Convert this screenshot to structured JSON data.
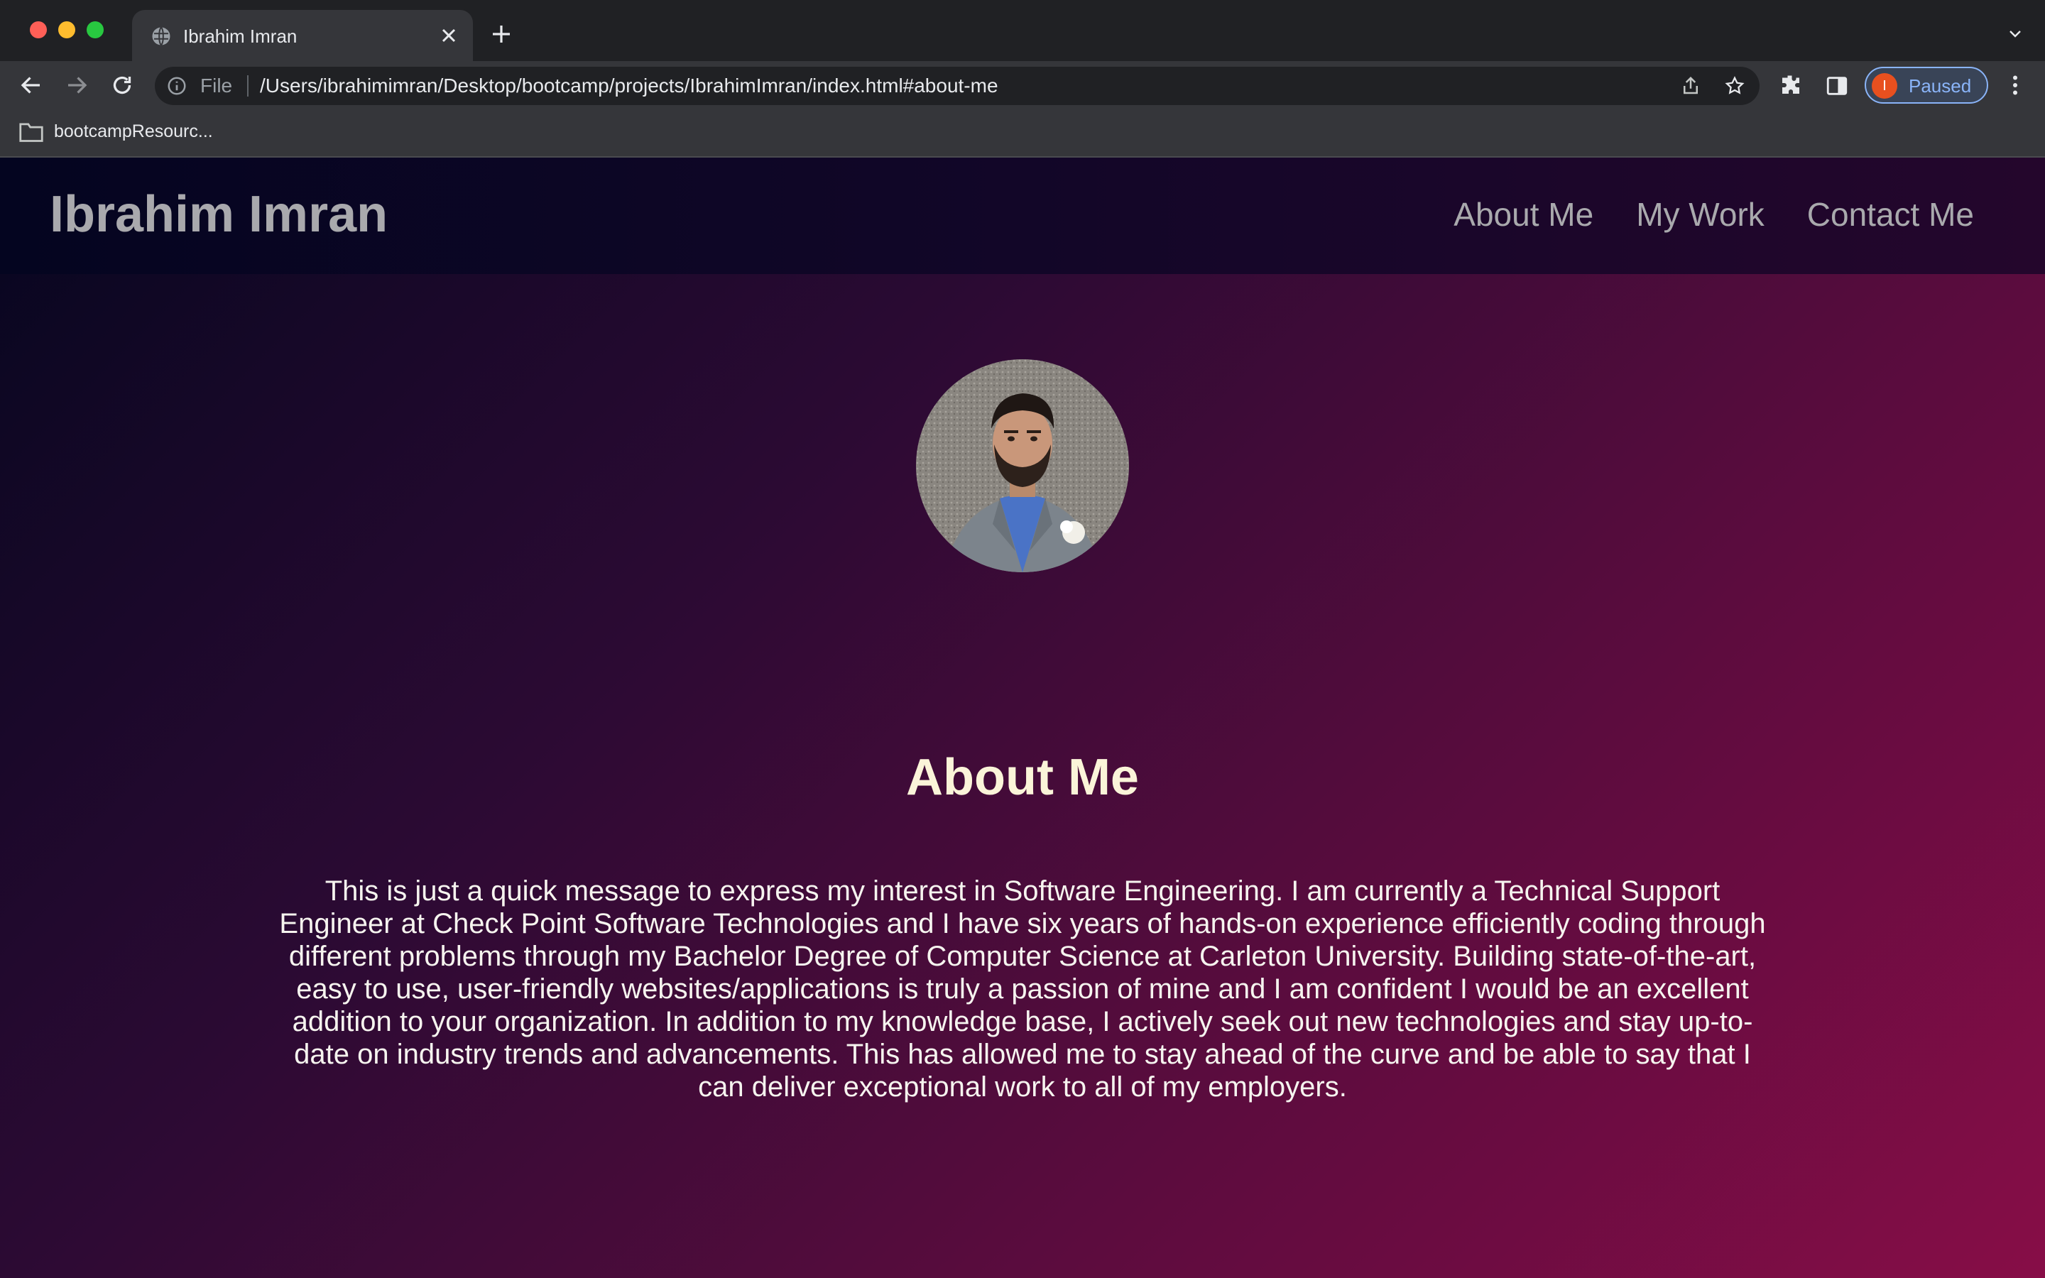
{
  "browser": {
    "tab_title": "Ibrahim Imran",
    "omnibox_scheme": "File",
    "url": "/Users/ibrahimimran/Desktop/bootcamp/projects/IbrahimImran/index.html#about-me",
    "profile_initial": "I",
    "profile_status": "Paused",
    "bookmark_folder": "bootcampResourc..."
  },
  "site": {
    "brand": "Ibrahim Imran",
    "nav": [
      "About Me",
      "My Work",
      "Contact Me"
    ]
  },
  "about": {
    "title": "About Me",
    "text": "This is just a quick message to express my interest in Software Engineering. I am currently a Technical Support Engineer at Check Point Software Technologies and I have six years of hands-on experience efficiently coding through different problems through my Bachelor Degree of Computer Science at Carleton University. Building state-of-the-art, easy to use, user-friendly websites/applications is truly a passion of mine and I am confident I would be an excellent addition to your organization. In addition to my knowledge base, I actively seek out new technologies and stay up-to-date on industry trends and advancements. This has allowed me to stay ahead of the curve and be able to say that I can deliver exceptional work to all of my employers."
  },
  "icons": {
    "tab_favicon": "globe-icon",
    "back": "back-arrow-icon",
    "forward": "forward-arrow-icon",
    "reload": "reload-icon",
    "info": "info-icon",
    "share": "share-icon",
    "bookmark_star": "star-icon",
    "extensions": "puzzle-icon",
    "side_panel": "side-panel-icon",
    "menu": "kebab-menu-icon",
    "folder": "folder-icon"
  },
  "colors": {
    "profile_accent": "#8ab4f8",
    "profile_avatar": "#e8501f",
    "heading": "#fbf4d9",
    "nav_text": "#a9a9ad"
  }
}
